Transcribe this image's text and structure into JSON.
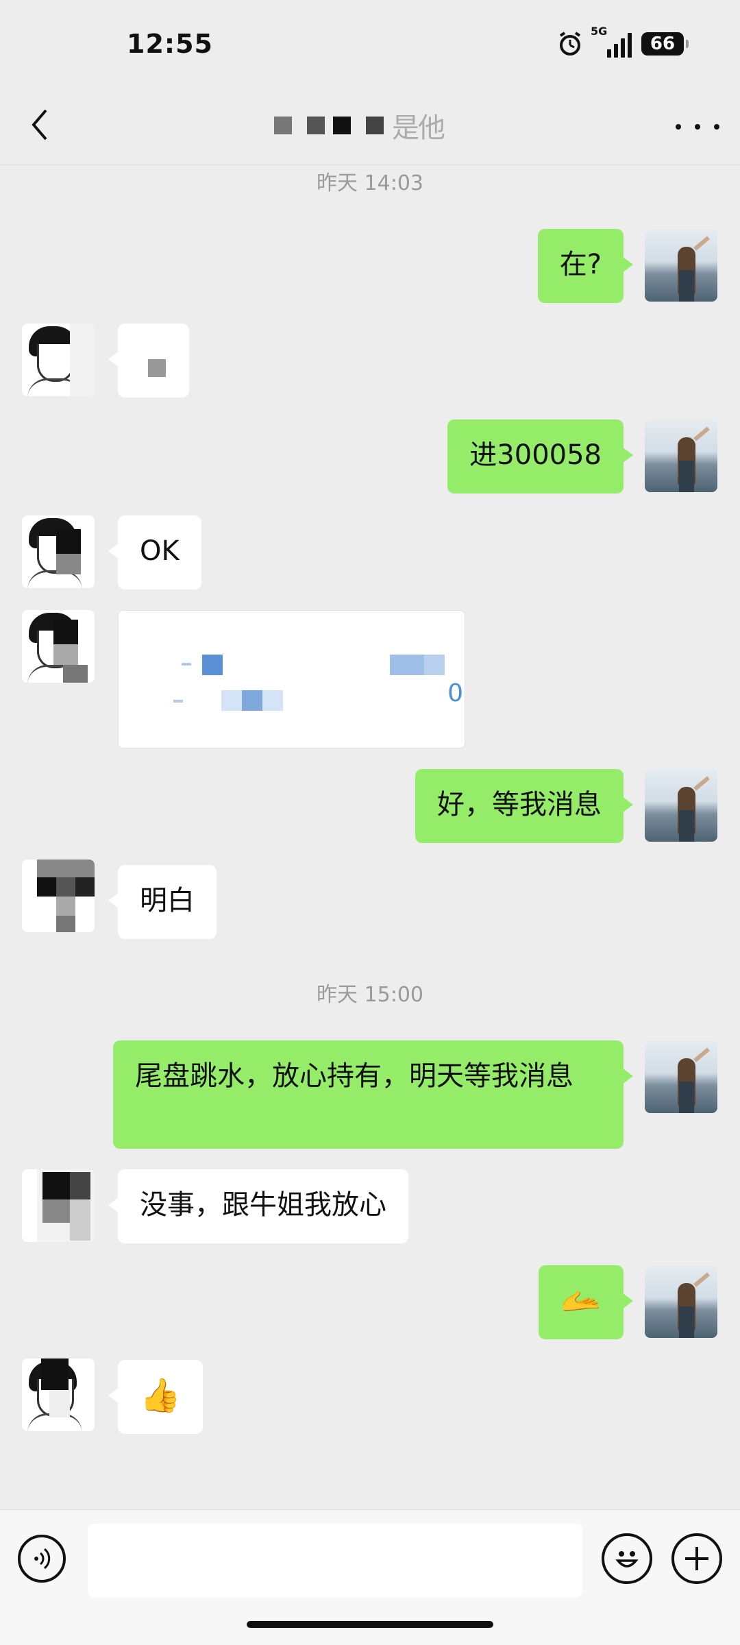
{
  "status_bar": {
    "time": "12:55",
    "network": "5G",
    "battery": "66"
  },
  "nav": {
    "title": "是他"
  },
  "chat": {
    "timestamps": [
      "昨天 14:03",
      "昨天 15:00"
    ],
    "messages": {
      "m1": "在?",
      "m2": "进300058",
      "m3": "OK",
      "m4_card_value": "0",
      "m5": "好，等我消息",
      "m6": "明白",
      "m7": "尾盘跳水，放心持有，明天等我消息",
      "m8": "没事，跟牛姐我放心",
      "m9_emoji": "🫴",
      "m10_emoji": "👍"
    }
  },
  "input_bar": {
    "placeholder": ""
  }
}
